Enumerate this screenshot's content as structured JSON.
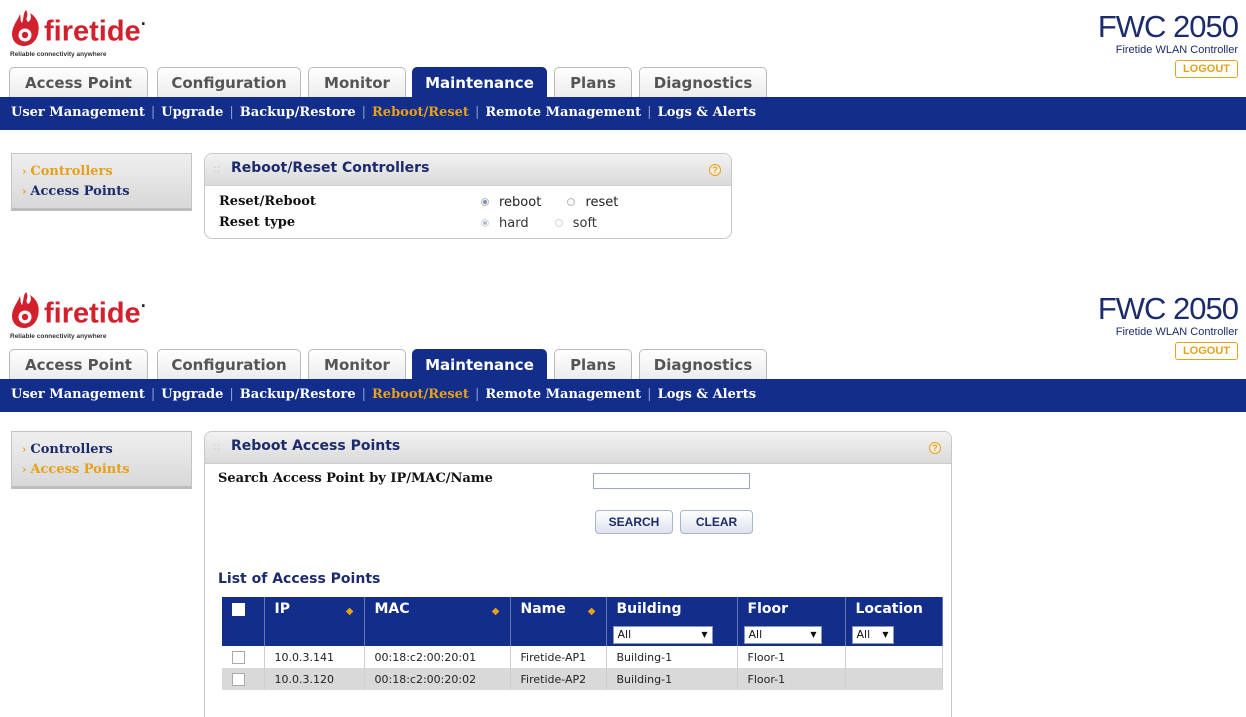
{
  "header": {
    "logo_text": "firetide",
    "tagline": "Reliable connectivity anywhere",
    "product_name": "FWC 2050",
    "product_subtitle": "Firetide WLAN Controller",
    "logout_label": "LOGOUT"
  },
  "tabs": [
    {
      "label": "Access Point"
    },
    {
      "label": "Configuration"
    },
    {
      "label": "Monitor"
    },
    {
      "label": "Maintenance",
      "active": true
    },
    {
      "label": "Plans"
    },
    {
      "label": "Diagnostics"
    }
  ],
  "subnav": [
    {
      "label": "User Management"
    },
    {
      "label": "Upgrade"
    },
    {
      "label": "Backup/Restore"
    },
    {
      "label": "Reboot/Reset",
      "active": true
    },
    {
      "label": "Remote Management"
    },
    {
      "label": "Logs & Alerts"
    }
  ],
  "screen1": {
    "menu": [
      {
        "label": "Controllers",
        "active": true
      },
      {
        "label": "Access Points",
        "active": false
      }
    ],
    "panel": {
      "title": "Reboot/Reset Controllers",
      "help": "?",
      "rows": [
        {
          "label": "Reset/Reboot",
          "options": [
            "reboot",
            "reset"
          ],
          "selected": "reboot"
        },
        {
          "label": "Reset type",
          "options": [
            "hard",
            "soft"
          ],
          "selected": "hard"
        }
      ]
    }
  },
  "screen2": {
    "menu": [
      {
        "label": "Controllers",
        "active": false
      },
      {
        "label": "Access Points",
        "active": true
      }
    ],
    "panel": {
      "title": "Reboot Access Points",
      "help": "?",
      "search_label": "Search Access Point by IP/MAC/Name",
      "search_value": "",
      "search_button": "SEARCH",
      "clear_button": "CLEAR",
      "list_title": "List of Access Points",
      "columns": [
        "IP",
        "MAC",
        "Name",
        "Building",
        "Floor",
        "Location"
      ],
      "filters": {
        "building": "All",
        "floor": "All",
        "location": "All"
      },
      "rows": [
        {
          "ip": "10.0.3.141",
          "mac": "00:18:c2:00:20:01",
          "name": "Firetide-AP1",
          "building": "Building-1",
          "floor": "Floor-1",
          "location": ""
        },
        {
          "ip": "10.0.3.120",
          "mac": "00:18:c2:00:20:02",
          "name": "Firetide-AP2",
          "building": "Building-1",
          "floor": "Floor-1",
          "location": ""
        }
      ]
    }
  },
  "colors": {
    "brand_red": "#d3202d",
    "nav_blue": "#132d8a",
    "accent_orange": "#e6a11a",
    "text_navy": "#1c2b6b"
  }
}
